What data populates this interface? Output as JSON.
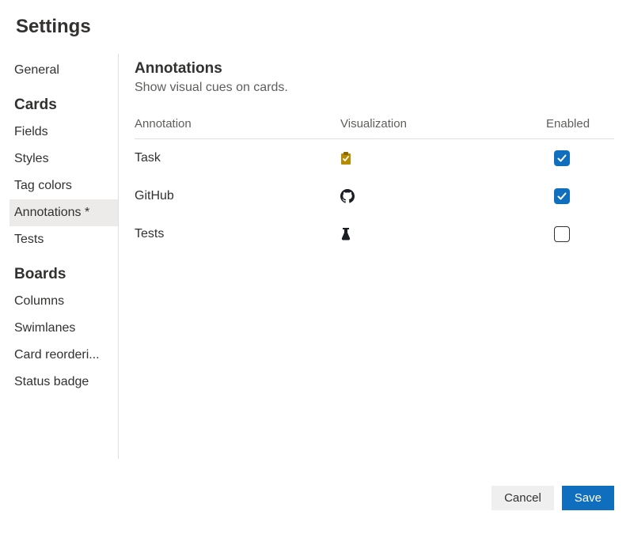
{
  "pageTitle": "Settings",
  "sidebar": {
    "topItems": [
      {
        "label": "General",
        "selected": false
      }
    ],
    "sections": [
      {
        "heading": "Cards",
        "items": [
          {
            "label": "Fields",
            "selected": false
          },
          {
            "label": "Styles",
            "selected": false
          },
          {
            "label": "Tag colors",
            "selected": false
          },
          {
            "label": "Annotations *",
            "selected": true
          },
          {
            "label": "Tests",
            "selected": false
          }
        ]
      },
      {
        "heading": "Boards",
        "items": [
          {
            "label": "Columns",
            "selected": false
          },
          {
            "label": "Swimlanes",
            "selected": false
          },
          {
            "label": "Card reorderi...",
            "selected": false
          },
          {
            "label": "Status badge",
            "selected": false
          }
        ]
      }
    ]
  },
  "panel": {
    "title": "Annotations",
    "subtitle": "Show visual cues on cards.",
    "columns": {
      "annotation": "Annotation",
      "visualization": "Visualization",
      "enabled": "Enabled"
    },
    "rows": [
      {
        "annotation": "Task",
        "icon": "clipboard-check-icon",
        "enabled": true
      },
      {
        "annotation": "GitHub",
        "icon": "github-icon",
        "enabled": true
      },
      {
        "annotation": "Tests",
        "icon": "beaker-icon",
        "enabled": false
      }
    ]
  },
  "buttons": {
    "cancel": "Cancel",
    "save": "Save"
  }
}
